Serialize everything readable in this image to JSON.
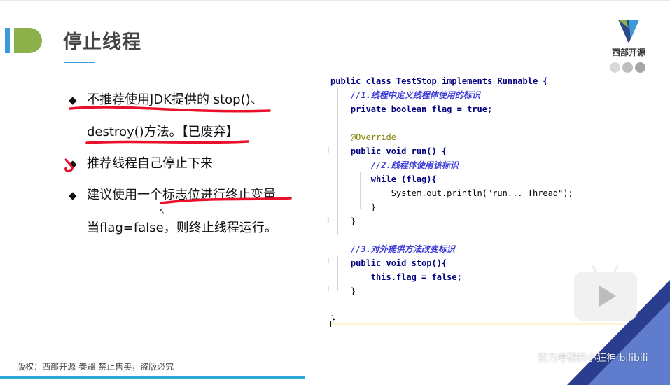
{
  "slide": {
    "title": "停止线程",
    "logo_text": "西部开源",
    "bullets": [
      {
        "symbol": "◆",
        "text": "不推荐使用JDK提供的 stop()、"
      },
      {
        "symbol": "",
        "text": "destroy()方法。【已废弃】"
      },
      {
        "symbol": "◆",
        "text": "推荐线程自己停止下来"
      },
      {
        "symbol": "◆",
        "text": "建议使用一个标志位进行终止变量"
      },
      {
        "symbol": "",
        "text": "当flag=false，则终止线程运行。"
      }
    ]
  },
  "code": {
    "lines": [
      "public class TestStop implements Runnable {",
      "    //1.线程中定义线程体使用的标识",
      "    private boolean flag = true;",
      "",
      "    @Override",
      "    public void run() {",
      "        //2.线程体使用该标识",
      "        while (flag){",
      "            System.out.println(\"run... Thread\");",
      "        }",
      "    }",
      "",
      "    //3.对外提供方法改变标识",
      "    public void stop(){",
      "        this.flag = false;",
      "    }",
      "",
      "}"
    ]
  },
  "footer": {
    "copyright": "版权：西部开源-秦疆     禁止售卖，盗版必究"
  },
  "overlay": {
    "watermark": "努力考研的小狂神 bilibili"
  },
  "colors": {
    "accent_blue": "#3b9ad9",
    "accent_green": "#8cb04a",
    "ink_red": "#e8102a",
    "code_keyword": "#000080",
    "code_comment": "#3c3cd8",
    "deco_dark": "#2b3d8f",
    "deco_light": "#6a88d8"
  },
  "icons": {
    "logo": "xibu-kaiyuan-logo",
    "play": "play-icon",
    "cursor": "mouse-cursor-icon"
  }
}
